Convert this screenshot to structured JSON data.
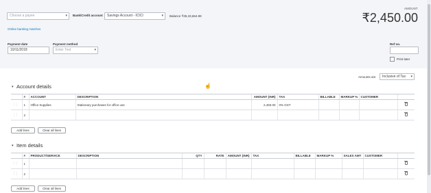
{
  "header": {
    "payee_placeholder": "Choose a payee",
    "bank_account_label": "Bank/Credit account",
    "bank_account_value": "Savings Account - ICICI",
    "balance_label": "Balance ₹35,33,664.98",
    "online_banking_link": "Online banking matches",
    "amount_label": "AMOUNT",
    "amount_value": "₹2,450.00",
    "payment_date_label": "Payment date",
    "payment_date_value": "10/11/2018",
    "payment_method_label": "Payment method",
    "payment_method_placeholder": "Enter Text",
    "ref_no_label": "Ref no.",
    "print_later_label": "Print later"
  },
  "amounts_are": {
    "label": "Amounts are",
    "value": "Inclusive of Tax"
  },
  "account_details": {
    "title": "Account details",
    "columns": [
      "#",
      "ACCOUNT",
      "DESCRIPTION",
      "AMOUNT (INR)",
      "TAX",
      "BILLABLE",
      "MARKUP %",
      "CUSTOMER"
    ],
    "rows": [
      {
        "num": "1",
        "account": "Office Supplies",
        "description": "Stationary purchases for office use",
        "amount": "2,450.00",
        "tax": "0% GST"
      },
      {
        "num": "2",
        "account": "",
        "description": "",
        "amount": "",
        "tax": ""
      }
    ],
    "add_lines": "Add lines",
    "clear_all_lines": "Clear all lines"
  },
  "item_details": {
    "title": "Item details",
    "columns": [
      "#",
      "PRODUCT/SERVICE",
      "DESCRIPTION",
      "QTY",
      "RATE",
      "AMOUNT (INR)",
      "TAX",
      "BILLABLE",
      "MARKUP %",
      "SALES AMT",
      "CUSTOMER"
    ],
    "rows": [
      {
        "num": "1"
      },
      {
        "num": "2"
      }
    ],
    "add_lines": "Add lines",
    "clear_all_lines": "Clear all lines"
  },
  "colors": {
    "header_bg": "#f4f5f8",
    "link": "#0077c5"
  }
}
